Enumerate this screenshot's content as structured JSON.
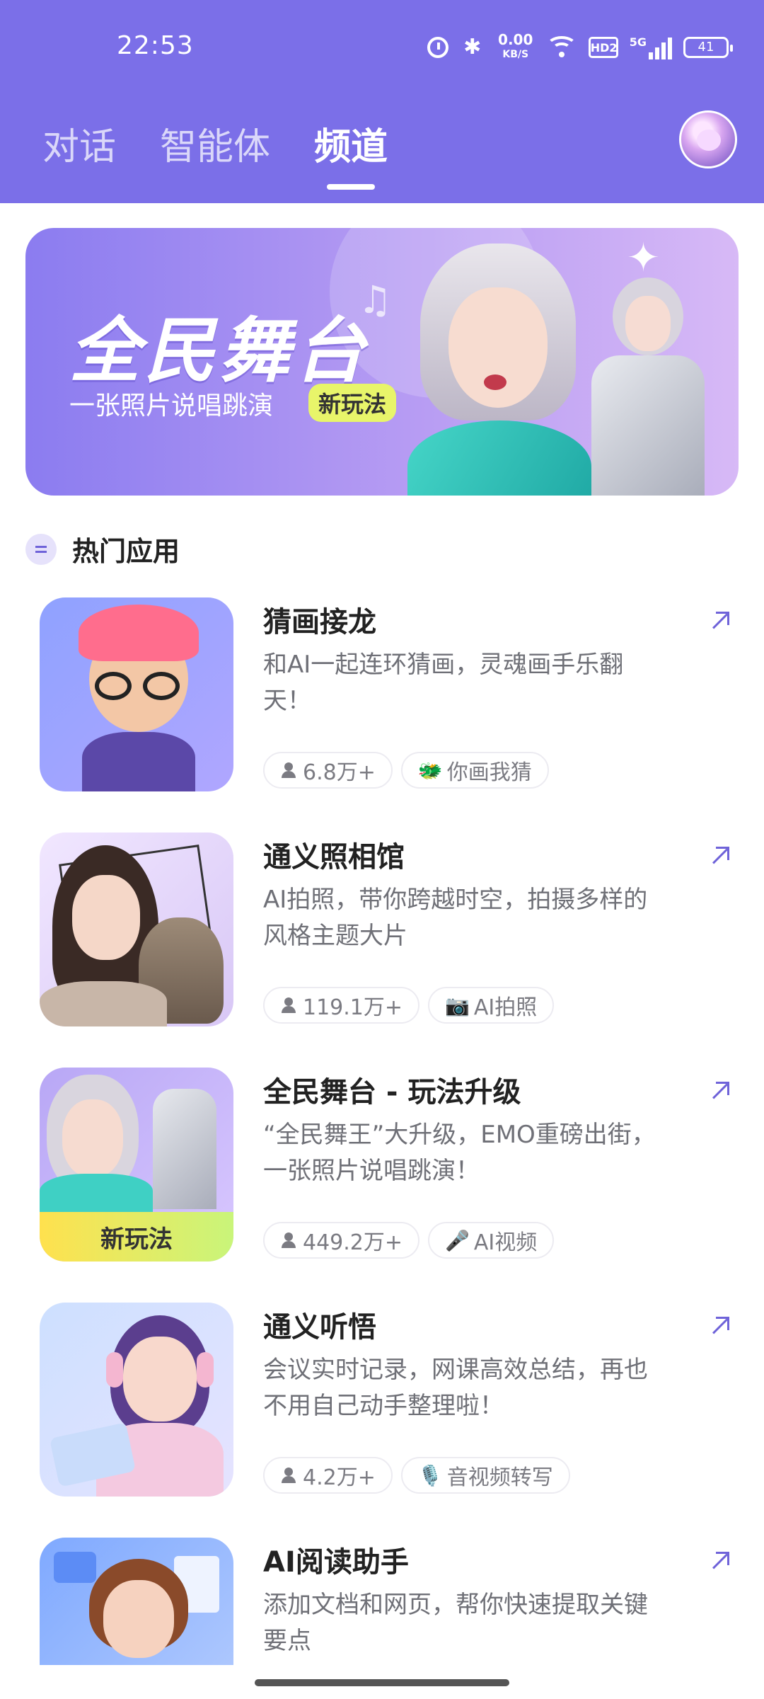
{
  "status_bar": {
    "time": "22:53",
    "net_speed_value": "0.00",
    "net_speed_unit": "KB/S",
    "hd_label": "HD2",
    "network": "5G",
    "battery": "41"
  },
  "header": {
    "tabs": [
      {
        "label": "对话"
      },
      {
        "label": "智能体"
      },
      {
        "label": "频道"
      }
    ],
    "active_tab": "频道"
  },
  "banner": {
    "title": "全民舞台",
    "subtitle": "一张照片说唱跳演",
    "badge": "新玩法"
  },
  "section": {
    "title": "热门应用"
  },
  "apps": [
    {
      "title": "猜画接龙",
      "description": "和AI一起连环猜画，灵魂画手乐翻天！",
      "users": "6.8万+",
      "tag_icon": "🐲",
      "tag": "你画我猜"
    },
    {
      "title": "通义照相馆",
      "description": "AI拍照，带你跨越时空，拍摄多样的风格主题大片",
      "users": "119.1万+",
      "tag_icon": "📷",
      "tag": "AI拍照"
    },
    {
      "title": "全民舞台 - 玩法升级",
      "description": "“全民舞王”大升级，EMO重磅出街，一张照片说唱跳演！",
      "users": "449.2万+",
      "tag_icon": "🎤",
      "tag": "AI视频",
      "thumb_badge": "新玩法"
    },
    {
      "title": "通义听悟",
      "description": "会议实时记录，网课高效总结，再也不用自己动手整理啦！",
      "users": "4.2万+",
      "tag_icon": "🎙️",
      "tag": "音视频转写"
    },
    {
      "title": "AI阅读助手",
      "description": "添加文档和网页，帮你快速提取关键要点"
    }
  ],
  "colors": {
    "header_bg": "#7b6fe8",
    "accent": "#6f63d9",
    "badge_yellow": "#e8f56a"
  }
}
